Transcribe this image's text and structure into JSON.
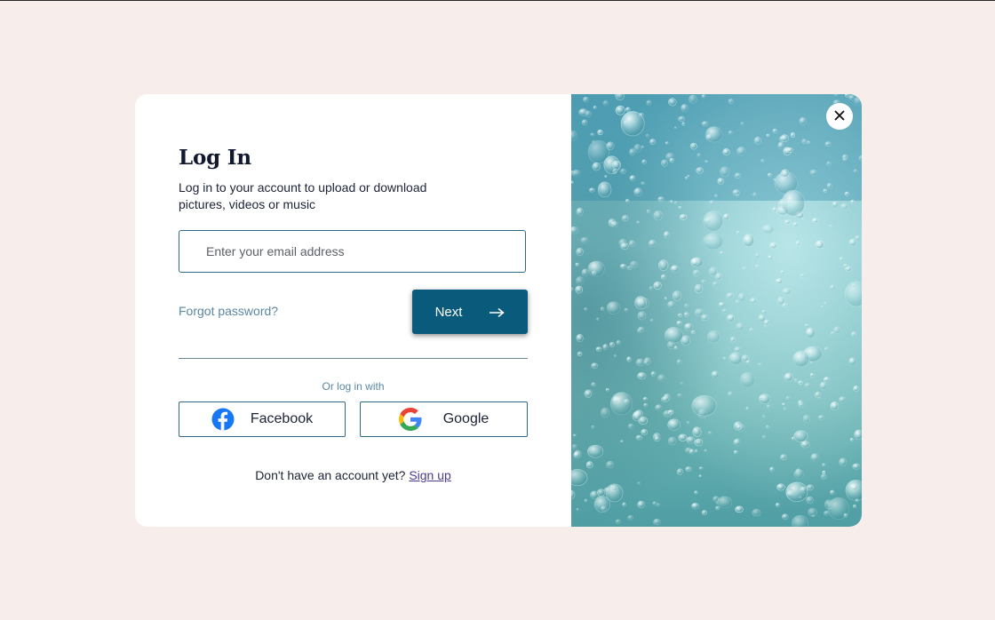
{
  "login": {
    "title": "Log In",
    "subtitle": "Log in to your account to upload or download pictures, videos or music",
    "email_placeholder": "Enter your email address",
    "forgot_password": "Forgot password?",
    "next_label": "Next",
    "or_text": "Or log in with",
    "facebook_label": "Facebook",
    "google_label": "Google",
    "no_account_text": "Don't have an account yet?",
    "signup_label": "Sign up"
  },
  "icons": {
    "next": "arrow-right-icon",
    "close": "close-icon",
    "facebook": "facebook-icon",
    "google": "google-icon"
  },
  "colors": {
    "page_background": "#f7eeec",
    "primary": "#0a5a7c",
    "link": "#5b87a0",
    "signup_link": "#4a3a8c",
    "facebook": "#1877f2"
  },
  "image": {
    "subject": "water-bubbles-photo"
  }
}
